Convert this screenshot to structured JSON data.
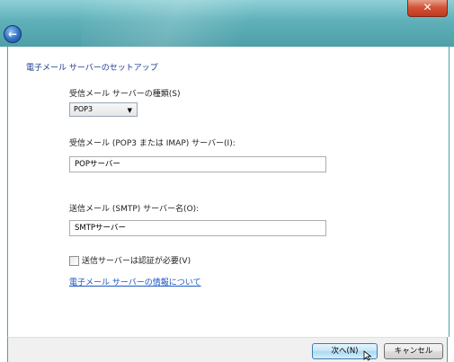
{
  "titlebar": {
    "close_label": "✕",
    "back_icon": "back-arrow-icon"
  },
  "dialog": {
    "heading": "電子メール サーバーのセットアップ",
    "server_type_label": "受信メール サーバーの種類(S)",
    "server_type_value": "POP3",
    "incoming_label": "受信メール (POP3 または IMAP) サーバー(I):",
    "incoming_value": "POPサーバー",
    "outgoing_label": "送信メール (SMTP) サーバー名(O):",
    "outgoing_value": "SMTPサーバー",
    "auth_checkbox_label": "送信サーバーは認証が必要(V)",
    "auth_checked": false,
    "info_link": "電子メール サーバーの情報について"
  },
  "footer": {
    "next_label": "次へ(N)",
    "cancel_label": "キャンセル"
  }
}
